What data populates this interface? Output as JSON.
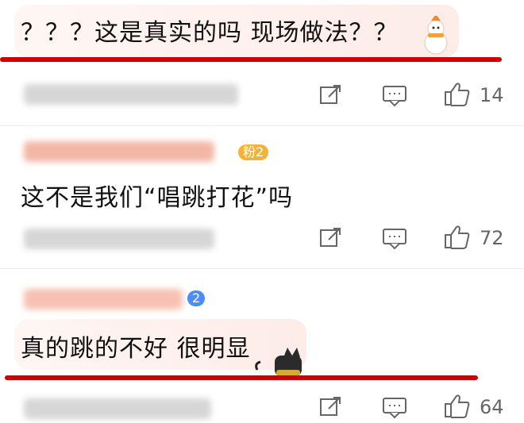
{
  "comments": [
    {
      "text": "？？？这是真实的吗 现场做法？？",
      "like_count": "14"
    },
    {
      "text": "这不是我们“唱跳打花”吗",
      "badge": "粉2",
      "like_count": "72"
    },
    {
      "text": "真的跳的不好 很明显",
      "badge": "2",
      "like_count": "64"
    }
  ],
  "colors": {
    "bubble_1": "#fde9e4",
    "bubble_2": "#fde9e4",
    "underline": "#d00000",
    "badge_2": "#f2b33a",
    "badge_3": "#4c8df6",
    "icon_gray": "#666666"
  },
  "icons": {
    "share": "share-icon",
    "comment": "comment-icon",
    "like": "thumbs-up-icon"
  }
}
